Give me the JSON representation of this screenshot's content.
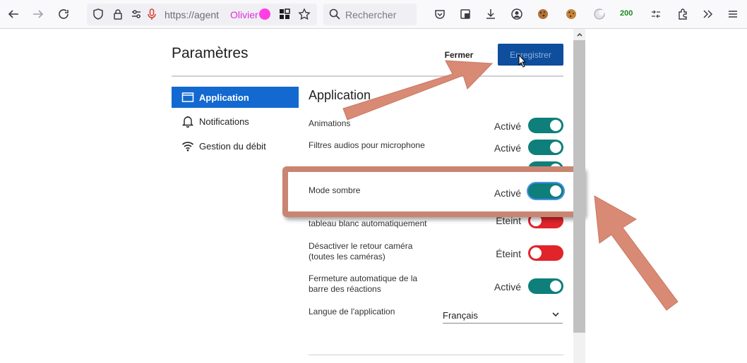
{
  "browser": {
    "url": "https://agent",
    "user_badge": "Olivier",
    "search_placeholder": "Rechercher",
    "extension_badge": "200"
  },
  "page": {
    "title": "Paramètres",
    "close_label": "Fermer",
    "save_label": "Enregistrer"
  },
  "nav": [
    {
      "label": "Application",
      "icon": "window-icon",
      "active": true
    },
    {
      "label": "Notifications",
      "icon": "bell-icon",
      "active": false
    },
    {
      "label": "Gestion du débit",
      "icon": "wifi-icon",
      "active": false
    }
  ],
  "section": {
    "title": "Application",
    "rows": [
      {
        "label_lines": [
          "Animations"
        ],
        "status": "Activé",
        "state": "on"
      },
      {
        "label_lines": [
          "Filtres audios pour microphone"
        ],
        "status": "Activé",
        "state": "on"
      },
      {
        "label_lines": [
          "Mode sombre"
        ],
        "status": "Activé",
        "state": "on"
      },
      {
        "label_lines": [
          "tableau blanc automatiquement"
        ],
        "status": "Éteint",
        "state": "off"
      },
      {
        "label_lines": [
          "Désactiver le retour caméra",
          "(toutes les caméras)"
        ],
        "status": "Éteint",
        "state": "off"
      },
      {
        "label_lines": [
          "Fermeture automatique de la",
          "barre des réactions"
        ],
        "status": "Activé",
        "state": "on"
      }
    ],
    "language_label": "Langue de l'application",
    "language_value": "Français"
  },
  "colors": {
    "toggle_on": "#0e7f7a",
    "toggle_off": "#e0242a",
    "nav_active": "#1369d0",
    "save_button": "#0e4e9c",
    "annotation_arrow": "#d98a75"
  }
}
